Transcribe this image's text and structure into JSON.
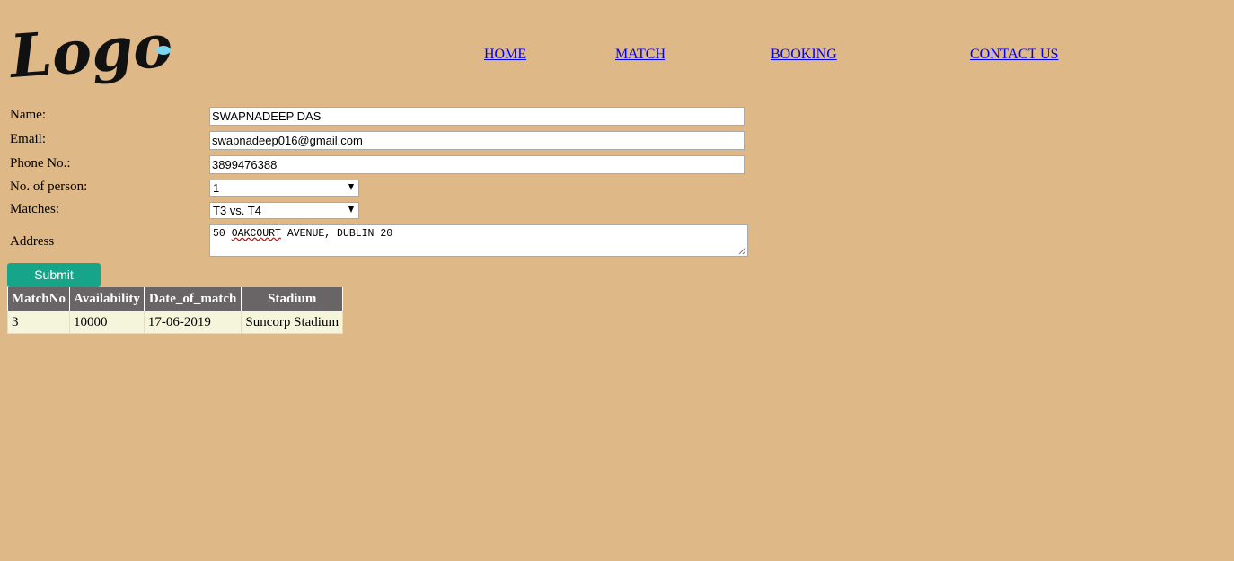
{
  "logo": {
    "text": "Logo",
    "dot_color": "#7fd4f0"
  },
  "nav": {
    "home": "HOME",
    "match": "MATCH",
    "booking": "BOOKING",
    "contact": "CONTACT US"
  },
  "form": {
    "name_label": "Name:",
    "name_value": "SWAPNADEEP DAS",
    "email_label": "Email:",
    "email_value": "swapnadeep016@gmail.com",
    "phone_label": "Phone No.:",
    "phone_value": "3899476388",
    "persons_label": "No. of person:",
    "persons_value": "1",
    "matches_label": "Matches:",
    "matches_value": "T3 vs. T4",
    "address_label": "Address",
    "address_part1": "50 ",
    "address_part2": "OAKCOURT",
    "address_part3": " AVENUE, DUBLIN 20",
    "submit_label": "Submit"
  },
  "table": {
    "headers": [
      "MatchNo",
      "Availability",
      "Date_of_match",
      "Stadium"
    ],
    "rows": [
      [
        "3",
        "10000",
        "17-06-2019",
        "Suncorp Stadium"
      ]
    ]
  },
  "colors": {
    "background": "#deb887",
    "submit": "#17a589",
    "table_header": "#696566",
    "table_cell": "#f5f5dc",
    "link": "#0000ee"
  }
}
